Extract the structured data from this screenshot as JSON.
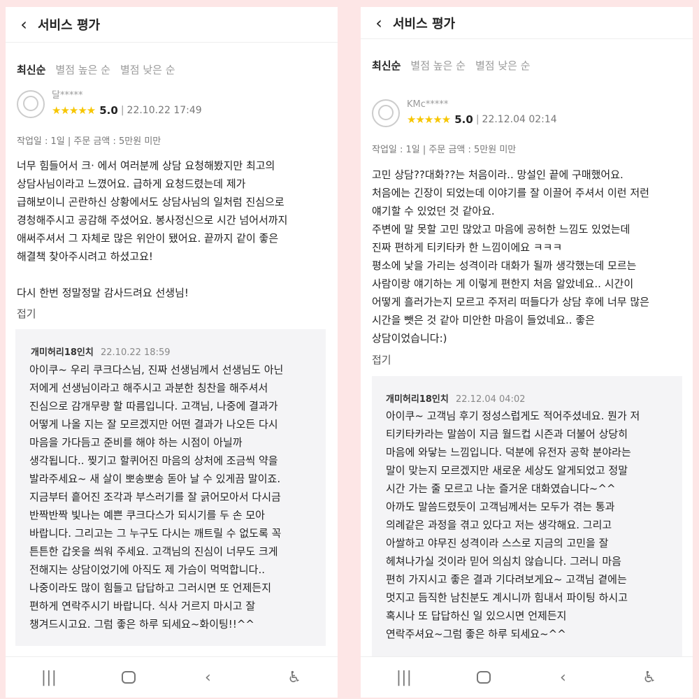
{
  "screens": [
    {
      "header": {
        "back_icon": "‹",
        "title": "서비스 평가"
      },
      "sort_tabs": [
        "최신순",
        "별점 높은 순",
        "별점 낮은 순"
      ],
      "review": {
        "username": "달*****",
        "stars": "★★★★★",
        "score": "5.0",
        "date": "22.10.22 17:49",
        "meta": "작업일 : 1일 | 주문 금액 : 5만원 미만",
        "body_lines": [
          "너무 힘들어서 크· 에서 여러분께 상담 요청해봤지만 최고의",
          "상담사님이라고 느꼈어요. 급하게 요청드렸는데 제가",
          "급해보이니 곤란하신 상황에서도 상담사님의 일처럼 진심으로",
          "경청해주시고 공감해 주셨어요. 봉사정신으로 시간 넘어서까지",
          "애써주셔서 그 자체로 많은 위안이 됐어요. 끝까지 같이 좋은",
          "해결책 찾아주시려고 하셨고요!",
          "",
          "다시 한번 정말정말 감사드려요 선생님!"
        ],
        "fold_label": "접기"
      },
      "reply": {
        "name": "개미허리18인치",
        "date": "22.10.22 18:59",
        "body_lines": [
          "아이쿠~ 우리 쿠크다스님, 진짜 선생님께서 선생님도 아닌",
          "저에게 선생님이라고 해주시고 과분한 칭찬을 해주셔서",
          "진심으로 감개무량 할 따름입니다. 고객님, 나중에 결과가",
          "어떻게 나올 지는 잘 모르겠지만 어떤 결과가 나오든 다시",
          "마음을 가다듬고 준비를 해야 하는 시점이 아닐까",
          "생각됩니다.. 찢기고 할퀴어진 마음의 상처에 조금씩 약을",
          "발라주세요~ 새 살이 뽀송뽀송 돋아 날 수 있게끔 말이죠.",
          "지금부터 흩어진 조각과 부스러기를 잘 긁어모아서 다시금",
          "반짝반짝 빛나는 예쁜 쿠크다스가 되시기를 두 손 모아",
          "바랍니다. 그리고는 그 누구도 다시는 깨트릴 수 없도록 꼭",
          "튼튼한 갑옷을 씌워 주세요. 고객님의 진심이 너무도 크게",
          "전해지는 상담이었기에 아직도 제 가슴이 먹먹합니다..",
          "나중이라도 많이 힘들고 답답하고 그러시면 또 언제든지",
          "편하게 연락주시기 바랍니다. 식사 거르지 마시고 잘",
          "챙겨드시고요. 그럼 좋은 하루 되세요~화이팅!!^^"
        ]
      }
    },
    {
      "header": {
        "back_icon": "‹",
        "title": "서비스 평가"
      },
      "sort_tabs": [
        "최신순",
        "별점 높은 순",
        "별점 낮은 순"
      ],
      "review": {
        "username": "KMc*****",
        "stars": "★★★★★",
        "score": "5.0",
        "date": "22.12.04 02:14",
        "meta": "작업일 : 1일 | 주문 금액 : 5만원 미만",
        "body_lines": [
          "고민 상담??대화??는 처음이라.. 망설인 끝에 구매했어요.",
          "처음에는 긴장이 되었는데 이야기를 잘 이끌어 주셔서 이런 저런",
          "얘기할 수 있었던 것 같아요.",
          "주변에 말 못할 고민 많았고 마음에 공허한 느낌도 있었는데",
          "진짜 편하게 티키타카 한 느낌이에요 ㅋㅋㅋ",
          "평소에 낯을 가리는 성격이라 대화가 될까 생각했는데 모르는",
          "사람이랑 얘기하는 게 이렇게 편한지 처음 알았네요.. 시간이",
          "어떻게 흘러가는지 모르고 주저리 떠들다가 상담 후에 너무 많은",
          "시간을 뺏은 것 같아 미안한 마음이 들었네요.. 좋은",
          "상담이었습니다:)"
        ],
        "fold_label": "접기"
      },
      "reply": {
        "name": "개미허리18인치",
        "date": "22.12.04 04:02",
        "body_lines": [
          "아이쿠~ 고객님 후기 정성스럽게도 적어주셨네요. 뭔가 저",
          "티키타카라는 말씀이 지금 월드컵 시즌과 더불어 상당히",
          "마음에 와닿는 느낌입니다. 덕분에 유전자 공학 분야라는",
          "말이 맞는지 모르겠지만 새로운 세상도 알게되었고 정말",
          "시간 가는 줄 모르고 나눈 즐거운 대화였습니다~^^",
          "아까도 말씀드렸듯이 고객님께서는 모두가 겪는 통과",
          "의례같은 과정을 겪고 있다고 저는 생각해요. 그리고",
          "아쌀하고 야무진 성격이라 스스로 지금의 고민을 잘",
          "헤쳐나가실 것이라 믿어 의심치 않습니다. 그러니 마음",
          "편히 가지시고 좋은 결과 기다려보게요~ 고객님 곁에는",
          "멋지고 듬직한 남친분도 계시니까 힘내서 파이팅 하시고",
          "혹시나 또 답답하신 일 있으시면 언제든지",
          "연락주셔요~그럼 좋은 하루 되세요~^^"
        ]
      }
    }
  ],
  "navbar": {
    "recents_icon": "|||",
    "back_icon": "‹",
    "accessibility_icon": "♿"
  },
  "colors": {
    "accent_star": "#f7c600",
    "background": "#fde6e6",
    "reply_bg": "#f4f4f6"
  }
}
